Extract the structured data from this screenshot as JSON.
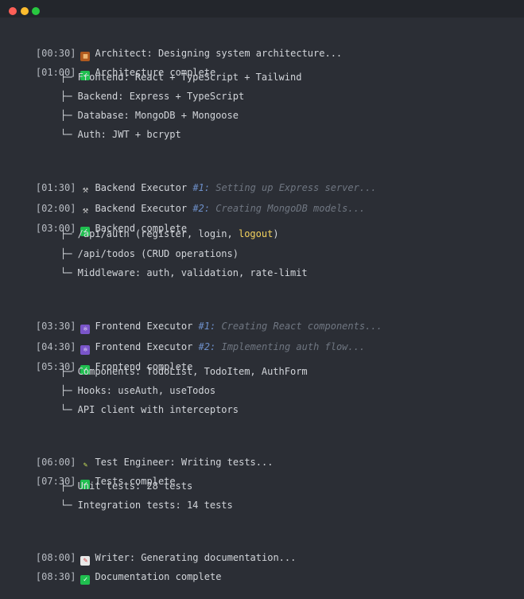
{
  "window": {
    "title": ""
  },
  "log": {
    "architect": {
      "ts": "[00:30]",
      "text": "Architect: Designing system architecture..."
    },
    "arch_done": {
      "ts": "[01:00]",
      "text": "Architecture complete"
    },
    "arch_items": [
      "├─ Frontend: React + TypeScript + Tailwind",
      "├─ Backend: Express + TypeScript",
      "├─ Database: MongoDB + Mongoose",
      "└─ Auth: JWT + bcrypt"
    ],
    "be1": {
      "ts": "[01:30]",
      "label": "Backend Executor",
      "num": "#1:",
      "task": "Setting up Express server..."
    },
    "be2": {
      "ts": "[02:00]",
      "label": "Backend Executor",
      "num": "#2:",
      "task": "Creating MongoDB models..."
    },
    "be_done": {
      "ts": "[03:00]",
      "text": "Backend complete"
    },
    "be_items": {
      "auth_prefix": "├─ /api/auth (register, login, ",
      "auth_hl": "logout",
      "auth_suffix": ")",
      "todos": "├─ /api/todos (CRUD operations)",
      "mw": "└─ Middleware: auth, validation, rate-limit"
    },
    "fe1": {
      "ts": "[03:30]",
      "label": "Frontend Executor",
      "num": "#1:",
      "task": "Creating React components..."
    },
    "fe2": {
      "ts": "[04:30]",
      "label": "Frontend Executor",
      "num": "#2:",
      "task": "Implementing auth flow..."
    },
    "fe_done": {
      "ts": "[05:30]",
      "text": "Frontend complete"
    },
    "fe_items": [
      "├─ Components: TodoList, TodoItem, AuthForm",
      "├─ Hooks: useAuth, useTodos",
      "└─ API client with interceptors"
    ],
    "test": {
      "ts": "[06:00]",
      "text": "Test Engineer: Writing tests..."
    },
    "test_done": {
      "ts": "[07:30]",
      "text": "Tests complete"
    },
    "test_items": [
      "├─ Unit tests: 28 tests",
      "└─ Integration tests: 14 tests"
    ],
    "writer": {
      "ts": "[08:00]",
      "text": "Writer: Generating documentation..."
    },
    "doc_done": {
      "ts": "[08:30]",
      "text": "Documentation complete"
    }
  },
  "icons": {
    "architect": "building-icon",
    "done": "check-icon",
    "backend": "wrench-icon",
    "frontend": "atom-icon",
    "test": "pencil-icon",
    "writer": "memo-icon"
  },
  "colors": {
    "background": "#2b2e35",
    "titlebar": "#23262c",
    "check": "#1fbf4f",
    "highlight": "#f4d35e",
    "dim_italic": "#6f7681",
    "number": "#6d8fc9"
  }
}
